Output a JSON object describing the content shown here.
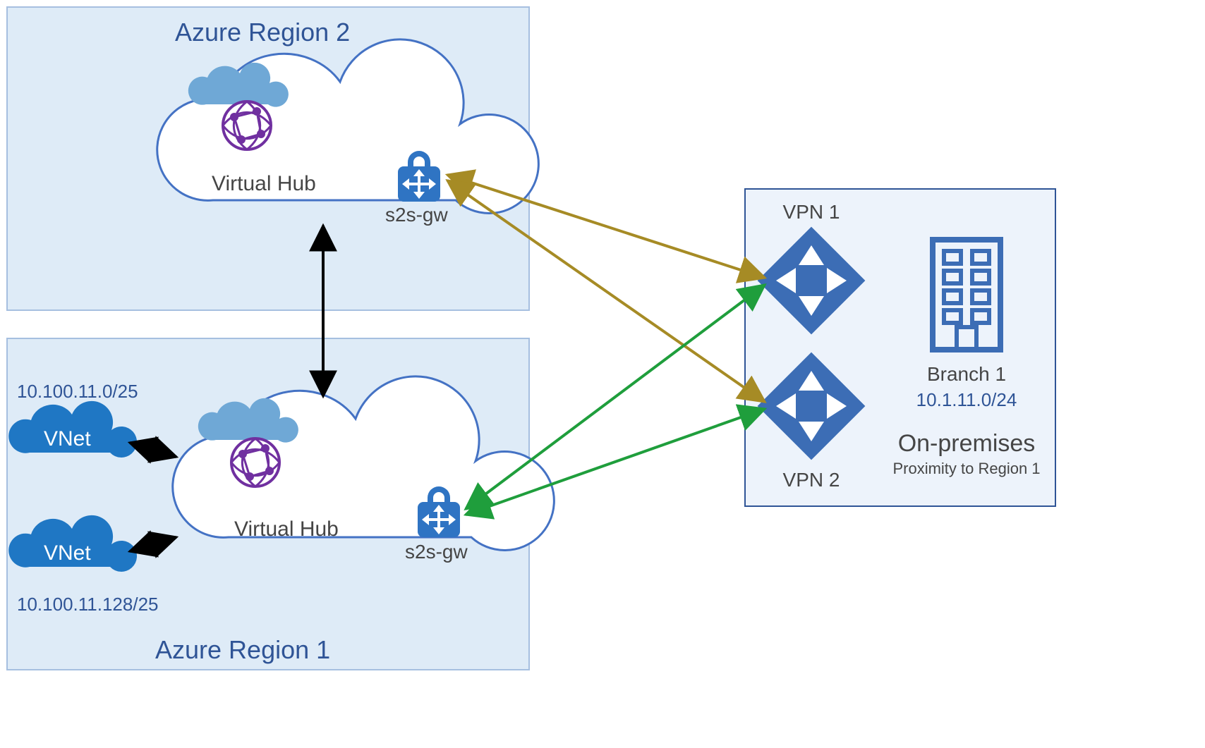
{
  "regions": {
    "region2": {
      "title": "Azure Region 2",
      "hub_label": "Virtual Hub",
      "gw_label": "s2s-gw"
    },
    "region1": {
      "title": "Azure Region 1",
      "hub_label": "Virtual Hub",
      "gw_label": "s2s-gw"
    }
  },
  "vnets": {
    "top": {
      "label": "VNet",
      "cidr": "10.100.11.0/25"
    },
    "bottom": {
      "label": "VNet",
      "cidr": "10.100.11.128/25"
    }
  },
  "onprem": {
    "title": "On-premises",
    "subtitle": "Proximity to Region 1",
    "branch_label": "Branch 1",
    "branch_cidr": "10.1.11.0/24",
    "vpn1_label": "VPN 1",
    "vpn2_label": "VPN 2"
  },
  "colors": {
    "region_fill": "#deebf7",
    "region_stroke": "#a6bfe0",
    "onprem_fill": "#edf3fb",
    "onprem_stroke": "#2f5496",
    "cloud_fill": "#ffffff",
    "cloud_stroke": "#4472c4",
    "hub_accent": "#5b9bd5",
    "azure_blue": "#2f74c3",
    "vnet_blue": "#1f77c4",
    "purple": "#7030a0",
    "building_blue": "#3c6db5",
    "arrow_black": "#000000",
    "arrow_olive": "#a68b25",
    "arrow_green": "#1f9e3c"
  }
}
